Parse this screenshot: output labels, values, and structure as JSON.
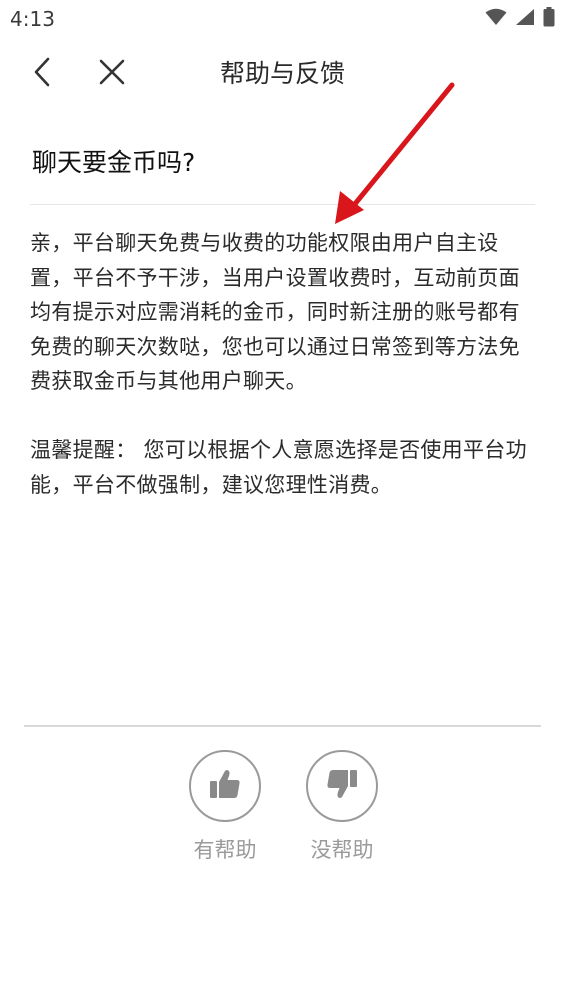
{
  "status_bar": {
    "time": "4:13",
    "icons": [
      "wifi-icon",
      "cellular-signal-icon",
      "battery-icon"
    ]
  },
  "header": {
    "title": "帮助与反馈",
    "icons": [
      "back-arrow-icon",
      "close-icon"
    ]
  },
  "article": {
    "question": "聊天要金币吗?",
    "paragraphs": [
      "亲，平台聊天免费与收费的功能权限由用户自主设置，平台不予干涉，当用户设置收费时，互动前页面均有提示对应需消耗的金币，同时新注册的账号都有免费的聊天次数哒，您也可以通过日常签到等方法免费获取金币与其他用户聊天。",
      "温馨提醒： 您可以根据个人意愿选择是否使用平台功能，平台不做强制，建议您理性消费。"
    ]
  },
  "feedback": {
    "helpful_label": "有帮助",
    "not_helpful_label": "没帮助",
    "icons": [
      "thumbs-up-icon",
      "thumbs-down-icon"
    ]
  },
  "colors": {
    "annotation_arrow": "#d9161b",
    "muted_gray": "#9a9a9a",
    "divider": "#e6e6e6"
  }
}
